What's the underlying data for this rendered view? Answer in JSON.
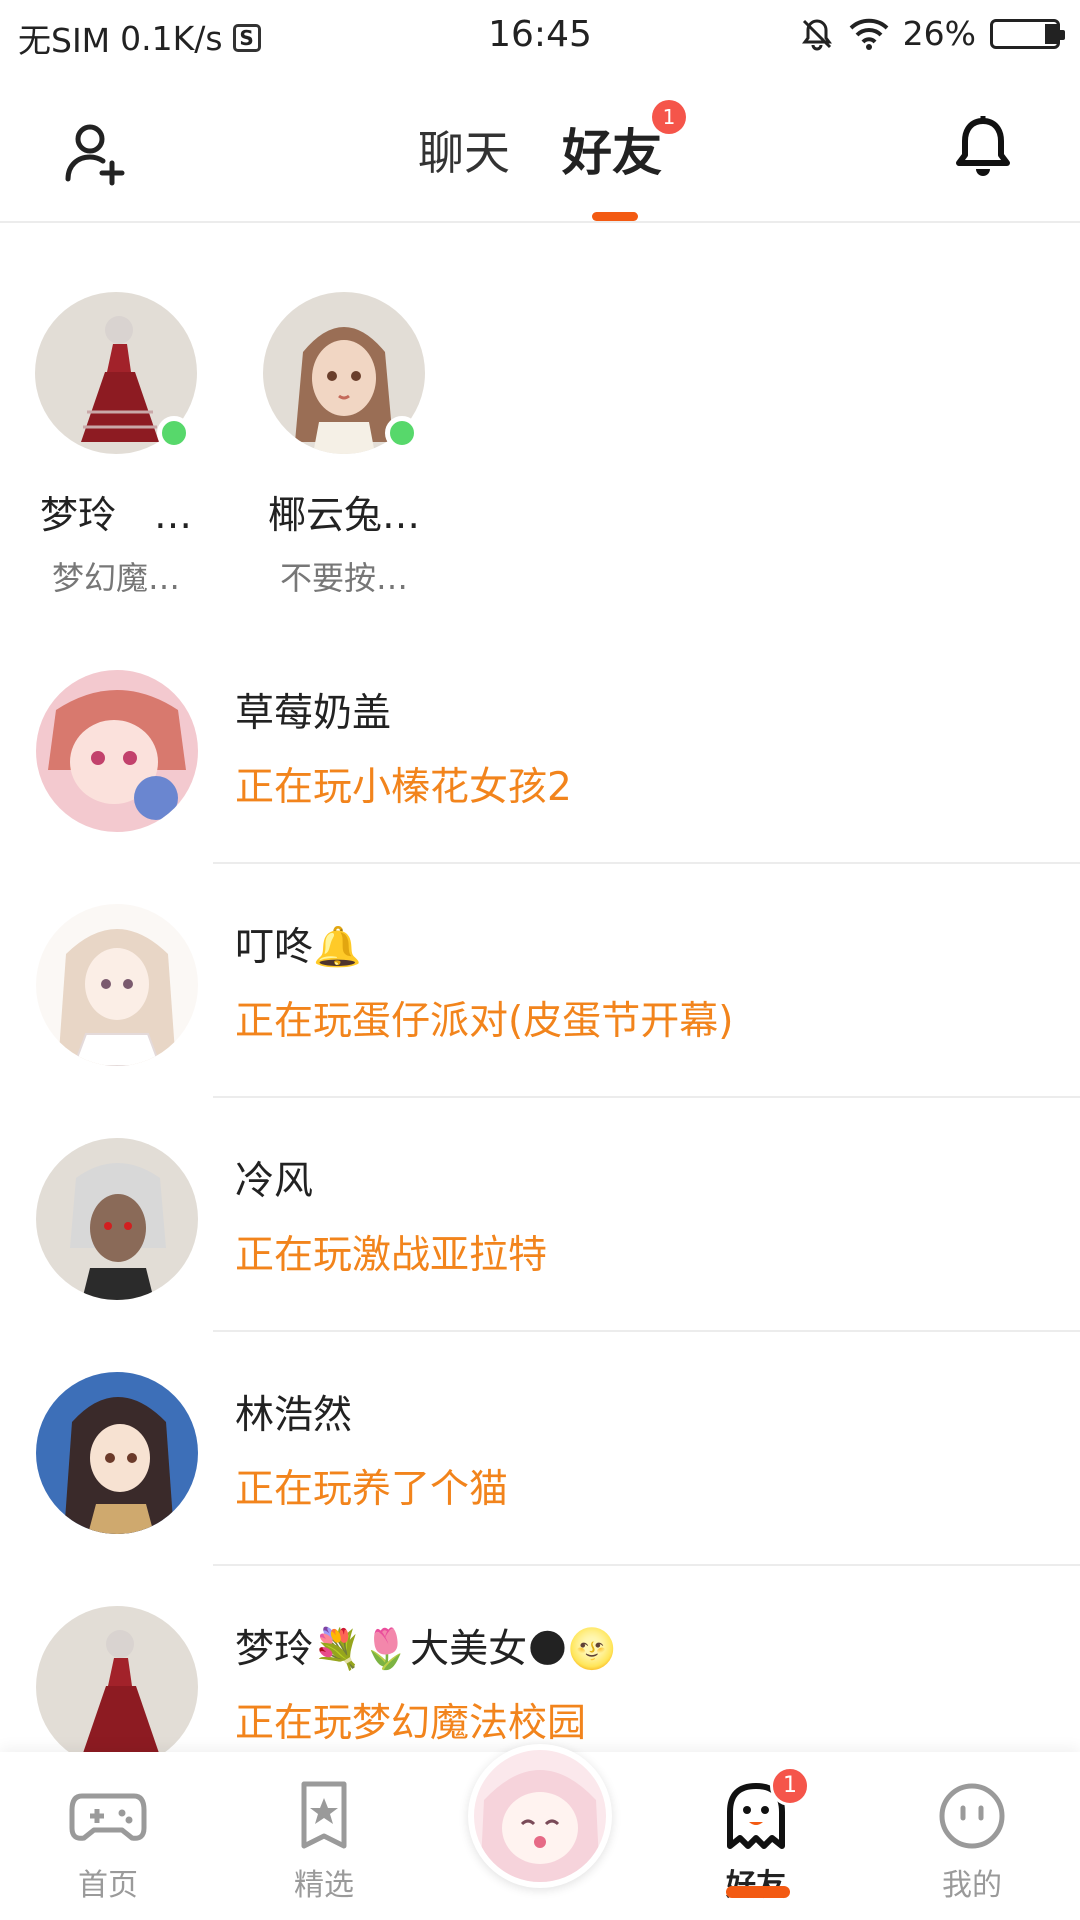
{
  "status_bar": {
    "carrier": "无SIM",
    "speed": "0.1K/s",
    "sim_icon": "S",
    "time": "16:45",
    "battery": "26%"
  },
  "header": {
    "tabs": [
      {
        "label": "聊天",
        "active": false
      },
      {
        "label": "好友",
        "active": true,
        "badge": "1"
      }
    ]
  },
  "online_friends": [
    {
      "name": "梦玲　…",
      "sub": "梦幻魔…"
    },
    {
      "name": "椰云兔…",
      "sub": "不要按…"
    }
  ],
  "friends": [
    {
      "name": "草莓奶盖",
      "status": "正在玩小榛花女孩2"
    },
    {
      "name": "叮咚🔔",
      "status": "正在玩蛋仔派对(皮蛋节开幕)"
    },
    {
      "name": "冷风",
      "status": "正在玩激战亚拉特"
    },
    {
      "name": "林浩然",
      "status": "正在玩养了个猫"
    },
    {
      "name": "梦玲💐🌷大美女🌑🌝",
      "status": "正在玩梦幻魔法校园"
    }
  ],
  "bottom_nav": [
    {
      "label": "首页",
      "icon": "gamepad-icon"
    },
    {
      "label": "精选",
      "icon": "star-bookmark-icon"
    },
    {
      "label": "",
      "icon": "center-avatar"
    },
    {
      "label": "好友",
      "icon": "ghost-icon",
      "badge": "1",
      "active": true
    },
    {
      "label": "我的",
      "icon": "face-icon"
    }
  ],
  "colors": {
    "accent": "#f35a12",
    "status_orange": "#f2841c",
    "badge_red": "#f5554a",
    "online_green": "#57d86b"
  }
}
